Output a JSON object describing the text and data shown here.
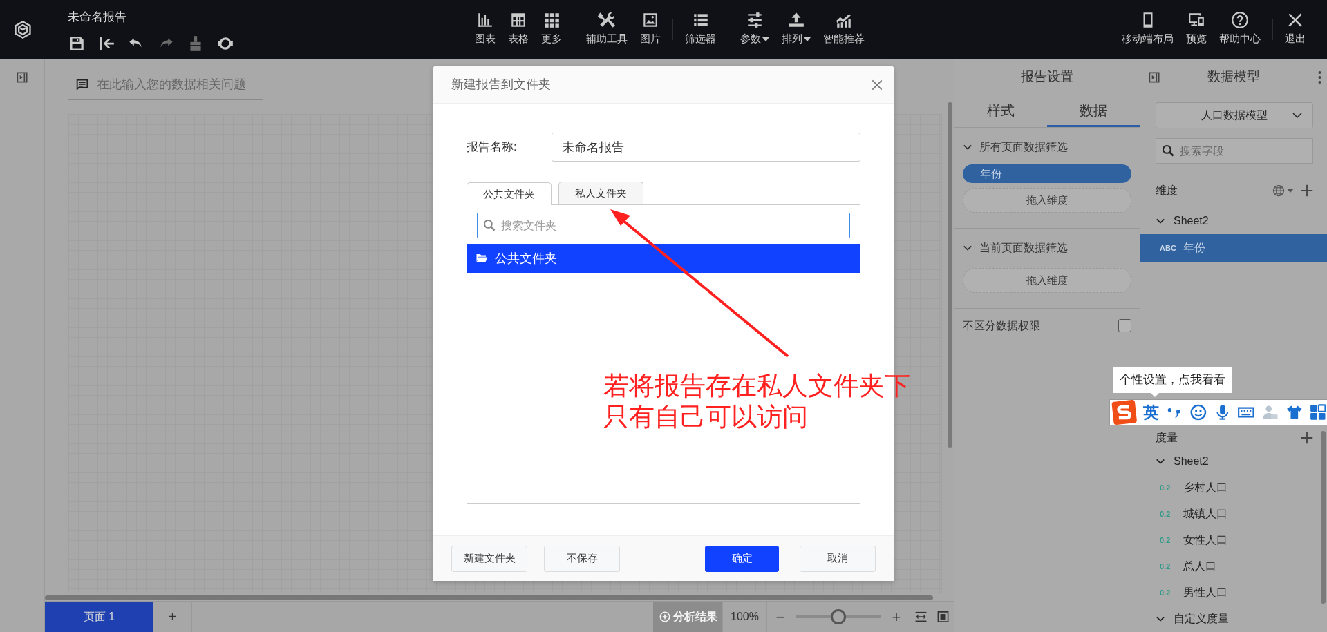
{
  "app": {
    "title": "未命名报告"
  },
  "quick_tools": [
    {
      "kind": "save",
      "disabled": false
    },
    {
      "kind": "back",
      "disabled": false
    },
    {
      "kind": "undo",
      "disabled": false
    },
    {
      "kind": "redo",
      "disabled": true
    },
    {
      "kind": "brush",
      "disabled": true
    },
    {
      "kind": "refresh",
      "disabled": false
    }
  ],
  "toolbar_groups": [
    [
      {
        "label": "图表",
        "kind": "chart",
        "dropdown": false
      },
      {
        "label": "表格",
        "kind": "table",
        "dropdown": false
      },
      {
        "label": "更多",
        "kind": "more",
        "dropdown": false
      }
    ],
    [
      {
        "label": "辅助工具",
        "kind": "tools",
        "dropdown": false
      },
      {
        "label": "图片",
        "kind": "image",
        "dropdown": false
      }
    ],
    [
      {
        "label": "筛选器",
        "kind": "filter",
        "dropdown": false
      }
    ],
    [
      {
        "label": "参数",
        "kind": "param",
        "dropdown": true
      },
      {
        "label": "排列",
        "kind": "sort",
        "dropdown": true
      },
      {
        "label": "智能推荐",
        "kind": "smart",
        "dropdown": false
      }
    ]
  ],
  "right_groups": [
    [
      {
        "label": "移动端布局",
        "kind": "mobile"
      },
      {
        "label": "预览",
        "kind": "preview"
      },
      {
        "label": "帮助中心",
        "kind": "help"
      }
    ],
    [
      {
        "label": "退出",
        "kind": "exit"
      }
    ]
  ],
  "question_box": {
    "placeholder": "在此输入您的数据相关问题"
  },
  "pages": [
    {
      "label": "页面 1",
      "selected": true
    }
  ],
  "add_page": "+",
  "zoom": {
    "analysis": "分析结果",
    "percent": "100%",
    "minus": "−",
    "plus": "+",
    "level": 0.5
  },
  "report_settings": {
    "title": "报告设置",
    "tabs": [
      {
        "label": "样式",
        "selected": false
      },
      {
        "label": "数据",
        "selected": true
      }
    ],
    "sections": [
      {
        "title": "所有页面数据筛选",
        "expanded": true,
        "chips": [
          "年份"
        ],
        "drop_hint": "拖入维度"
      },
      {
        "title": "当前页面数据筛选",
        "expanded": true,
        "drop_hint": "拖入维度"
      }
    ],
    "permission": {
      "label": "不区分数据权限",
      "checked": false
    }
  },
  "data_model": {
    "title": "数据模型",
    "model": "人口数据模型",
    "search_placeholder": "搜索字段",
    "dimensions": {
      "label": "维度",
      "groups": [
        {
          "name": "Sheet2",
          "expanded": true,
          "fields": [
            {
              "type": "ABC",
              "name": "年份",
              "selected": true
            }
          ]
        }
      ]
    },
    "measures": {
      "label": "度量",
      "groups": [
        {
          "name": "Sheet2",
          "expanded": true,
          "fields": [
            {
              "type": "0.2",
              "name": "乡村人口",
              "selected": false
            },
            {
              "type": "0.2",
              "name": "城镇人口",
              "selected": false
            },
            {
              "type": "0.2",
              "name": "女性人口",
              "selected": false
            },
            {
              "type": "0.2",
              "name": "总人口",
              "selected": false
            },
            {
              "type": "0.2",
              "name": "男性人口",
              "selected": false
            }
          ]
        },
        {
          "name": "自定义度量",
          "expanded": true
        }
      ]
    }
  },
  "dialog": {
    "title": "新建报告到文件夹",
    "name_label": "报告名称:",
    "name_value": "未命名报告",
    "tabs": [
      {
        "label": "公共文件夹",
        "selected": true
      },
      {
        "label": "私人文件夹",
        "selected": false
      }
    ],
    "search_placeholder": "搜索文件夹",
    "folders": [
      {
        "name": "公共文件夹",
        "selected": true
      }
    ],
    "buttons": [
      {
        "label": "新建文件夹",
        "kind": "default"
      },
      {
        "label": "不保存",
        "kind": "default"
      },
      {
        "label": "确定",
        "kind": "primary"
      },
      {
        "label": "取消",
        "kind": "default"
      }
    ]
  },
  "annotation": {
    "lines": [
      "若将报告存在私人文件夹下",
      "只有自己可以访问"
    ]
  },
  "ime_toolbar": {
    "tooltip": "个性设置，点我看看",
    "mode": "英"
  }
}
